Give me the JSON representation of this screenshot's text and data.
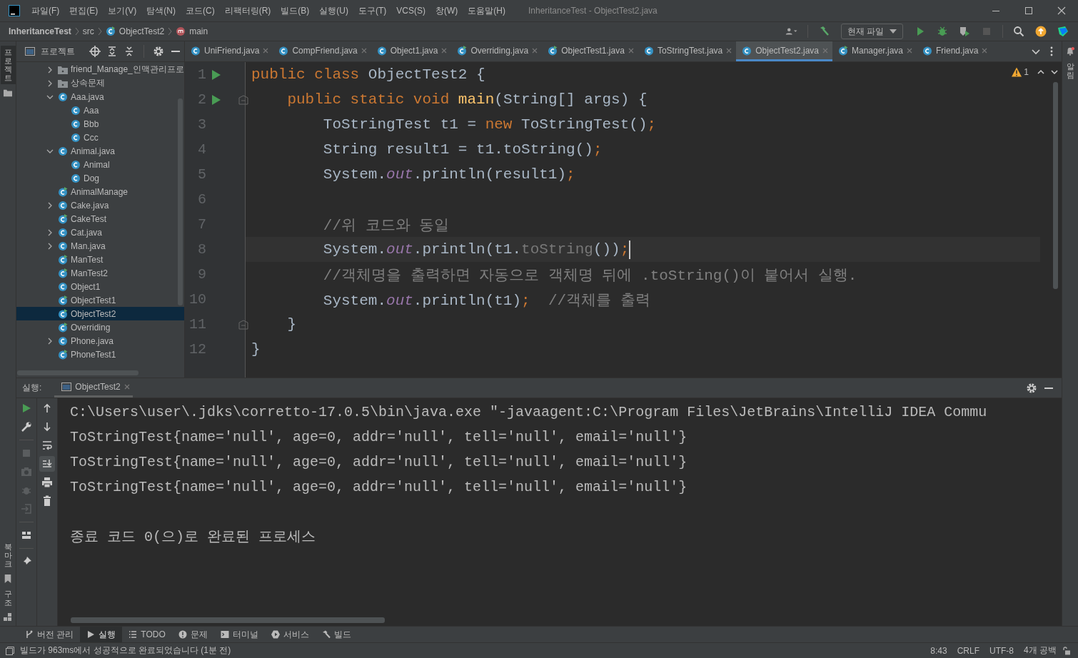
{
  "window": {
    "title": "InheritanceTest - ObjectTest2.java"
  },
  "menu": [
    "파일(F)",
    "편집(E)",
    "보기(V)",
    "탐색(N)",
    "코드(C)",
    "리팩터링(R)",
    "빌드(B)",
    "실행(U)",
    "도구(T)",
    "VCS(S)",
    "창(W)",
    "도움말(H)"
  ],
  "breadcrumbs": [
    {
      "label": "InheritanceTest",
      "kind": "project"
    },
    {
      "label": "src",
      "kind": "folder"
    },
    {
      "label": "ObjectTest2",
      "kind": "class"
    },
    {
      "label": "main",
      "kind": "method"
    }
  ],
  "run_config": "현재 파일",
  "left_tools": [
    {
      "label": "프로젝트",
      "selected": true
    },
    {
      "label": "북마크",
      "selected": false
    },
    {
      "label": "구조",
      "selected": false
    }
  ],
  "right_tools": [
    {
      "label": "알림"
    }
  ],
  "project_panel": {
    "title": "프로젝트",
    "tree": [
      {
        "label": "friend_Manage_인맥관리프로",
        "kind": "folder",
        "expanded": false,
        "selected": false
      },
      {
        "label": "상속문제",
        "kind": "folder",
        "expanded": false,
        "selected": false
      },
      {
        "label": "Aaa.java",
        "kind": "file",
        "expanded": true,
        "selected": false,
        "children": [
          {
            "label": "Aaa",
            "kind": "class",
            "selected": false
          },
          {
            "label": "Bbb",
            "kind": "class",
            "selected": false
          },
          {
            "label": "Ccc",
            "kind": "class",
            "selected": false
          }
        ]
      },
      {
        "label": "Animal.java",
        "kind": "file",
        "expanded": true,
        "selected": false,
        "children": [
          {
            "label": "Animal",
            "kind": "class",
            "selected": false
          },
          {
            "label": "Dog",
            "kind": "class",
            "selected": false
          }
        ]
      },
      {
        "label": "AnimalManage",
        "kind": "main-class",
        "selected": false
      },
      {
        "label": "Cake.java",
        "kind": "file",
        "expanded": false,
        "selected": false
      },
      {
        "label": "CakeTest",
        "kind": "main-class",
        "selected": false
      },
      {
        "label": "Cat.java",
        "kind": "file",
        "expanded": false,
        "selected": false
      },
      {
        "label": "Man.java",
        "kind": "file",
        "expanded": false,
        "selected": false
      },
      {
        "label": "ManTest",
        "kind": "main-class",
        "selected": false
      },
      {
        "label": "ManTest2",
        "kind": "main-class",
        "selected": false
      },
      {
        "label": "Object1",
        "kind": "class",
        "selected": false
      },
      {
        "label": "ObjectTest1",
        "kind": "main-class",
        "selected": false
      },
      {
        "label": "ObjectTest2",
        "kind": "main-class",
        "selected": true
      },
      {
        "label": "Overriding",
        "kind": "main-class",
        "selected": false
      },
      {
        "label": "Phone.java",
        "kind": "file",
        "expanded": false,
        "selected": false
      },
      {
        "label": "PhoneTest1",
        "kind": "main-class",
        "selected": false
      }
    ]
  },
  "editor": {
    "tabs": [
      {
        "label": "UniFriend.java",
        "kind": "class",
        "selected": false
      },
      {
        "label": "CompFriend.java",
        "kind": "class",
        "selected": false
      },
      {
        "label": "Object1.java",
        "kind": "class",
        "selected": false
      },
      {
        "label": "Overriding.java",
        "kind": "main-class",
        "selected": false
      },
      {
        "label": "ObjectTest1.java",
        "kind": "main-class",
        "selected": false
      },
      {
        "label": "ToStringTest.java",
        "kind": "class",
        "selected": false
      },
      {
        "label": "ObjectTest2.java",
        "kind": "class",
        "selected": true
      },
      {
        "label": "Manager.java",
        "kind": "main-class",
        "selected": false
      },
      {
        "label": "Friend.java",
        "kind": "class",
        "selected": false
      }
    ],
    "warnings": "1",
    "lines": [
      {
        "num": "1",
        "run": true,
        "fold": false,
        "current": false,
        "tokens": [
          {
            "text": "public class ",
            "kind": "keyword"
          },
          {
            "text": "ObjectTest2 {",
            "kind": "plain"
          }
        ]
      },
      {
        "num": "2",
        "run": true,
        "fold": true,
        "current": false,
        "tokens": [
          {
            "text": "    public static void ",
            "kind": "keyword"
          },
          {
            "text": "main",
            "kind": "method"
          },
          {
            "text": "(String[] args) {",
            "kind": "plain"
          }
        ]
      },
      {
        "num": "3",
        "run": false,
        "fold": false,
        "current": false,
        "tokens": [
          {
            "text": "        ToStringTest t1 = ",
            "kind": "plain"
          },
          {
            "text": "new ",
            "kind": "keyword"
          },
          {
            "text": "ToStringTest()",
            "kind": "plain"
          },
          {
            "text": ";",
            "kind": "keyword"
          }
        ]
      },
      {
        "num": "4",
        "run": false,
        "fold": false,
        "current": false,
        "tokens": [
          {
            "text": "        String result1 = t1.toString()",
            "kind": "plain"
          },
          {
            "text": ";",
            "kind": "keyword"
          }
        ]
      },
      {
        "num": "5",
        "run": false,
        "fold": false,
        "current": false,
        "tokens": [
          {
            "text": "        System.",
            "kind": "plain"
          },
          {
            "text": "out",
            "kind": "field"
          },
          {
            "text": ".println(result1)",
            "kind": "plain"
          },
          {
            "text": ";",
            "kind": "keyword"
          }
        ]
      },
      {
        "num": "6",
        "run": false,
        "fold": false,
        "current": false
      },
      {
        "num": "7",
        "run": false,
        "fold": false,
        "current": false,
        "tokens": [
          {
            "text": "        //위 코드와 동일",
            "kind": "comment"
          }
        ]
      },
      {
        "num": "8",
        "run": false,
        "fold": false,
        "current": true,
        "tokens": [
          {
            "text": "        System.",
            "kind": "plain"
          },
          {
            "text": "out",
            "kind": "field"
          },
          {
            "text": ".println(t1.",
            "kind": "plain"
          },
          {
            "text": "toString",
            "kind": "dim"
          },
          {
            "text": "())",
            "kind": "plain"
          },
          {
            "text": ";",
            "kind": "keyword"
          }
        ]
      },
      {
        "num": "9",
        "run": false,
        "fold": false,
        "current": false,
        "tokens": [
          {
            "text": "        //객체명을 출력하면 자동으로 객체명 뒤에 .toString()이 붙어서 실행.",
            "kind": "comment"
          }
        ]
      },
      {
        "num": "10",
        "run": false,
        "fold": false,
        "current": false,
        "tokens": [
          {
            "text": "        System.",
            "kind": "plain"
          },
          {
            "text": "out",
            "kind": "field"
          },
          {
            "text": ".println(t1)",
            "kind": "plain"
          },
          {
            "text": ";",
            "kind": "keyword"
          },
          {
            "text": "  //객체를 출력",
            "kind": "comment"
          }
        ]
      },
      {
        "num": "11",
        "run": false,
        "fold": true,
        "current": false,
        "tokens": [
          {
            "text": "    }",
            "kind": "plain"
          }
        ]
      },
      {
        "num": "12",
        "run": false,
        "fold": false,
        "current": false,
        "tokens": [
          {
            "text": "}",
            "kind": "plain"
          }
        ]
      }
    ]
  },
  "run_panel": {
    "title": "실행:",
    "tab": "ObjectTest2",
    "output": [
      {
        "text": "C:\\Users\\user\\.jdks\\corretto-17.0.5\\bin\\java.exe \"-javaagent:C:\\Program Files\\JetBrains\\IntelliJ IDEA Commu",
        "kind": "command"
      },
      {
        "text": "ToStringTest{name='null', age=0, addr='null', tell='null', email='null'}",
        "kind": "stdout"
      },
      {
        "text": "ToStringTest{name='null', age=0, addr='null', tell='null', email='null'}",
        "kind": "stdout"
      },
      {
        "text": "ToStringTest{name='null', age=0, addr='null', tell='null', email='null'}",
        "kind": "stdout"
      },
      {
        "text": "종료 코드 0(으)로 완료된 프로세스",
        "kind": "exit"
      }
    ]
  },
  "tool_tabs": [
    {
      "label": "버전 관리",
      "selected": false
    },
    {
      "label": "실행",
      "selected": true
    },
    {
      "label": "TODO",
      "selected": false
    },
    {
      "label": "문제",
      "selected": false
    },
    {
      "label": "터미널",
      "selected": false
    },
    {
      "label": "서비스",
      "selected": false
    },
    {
      "label": "빌드",
      "selected": false
    }
  ],
  "status_bar": {
    "message": "빌드가 963ms에서 성공적으로 완료되었습니다 (1분 전)",
    "items": [
      "8:43",
      "CRLF",
      "UTF-8",
      "4개 공백"
    ]
  }
}
